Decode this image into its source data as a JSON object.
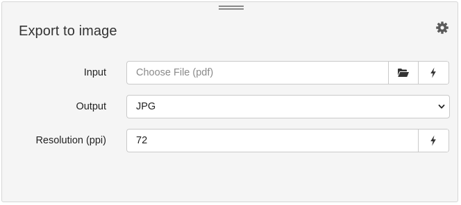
{
  "panel": {
    "title": "Export to image",
    "icons": {
      "settings": "gear-icon",
      "drag": "drag-handle-icon"
    }
  },
  "form": {
    "input": {
      "label": "Input",
      "placeholder": "Choose File  (pdf)",
      "value": "",
      "icons": [
        "folder-open-icon",
        "lightning-icon"
      ]
    },
    "output": {
      "label": "Output",
      "selected": "JPG",
      "icon": "chevron-down-icon"
    },
    "resolution": {
      "label": "Resolution (ppi)",
      "value": "72",
      "icon": "lightning-icon"
    }
  },
  "colors": {
    "panel_bg": "#f5f5f5",
    "field_bg": "#ffffff",
    "border": "#c9c9c9",
    "text": "#222222",
    "placeholder": "#8a8a8a",
    "icon": "#333333"
  }
}
